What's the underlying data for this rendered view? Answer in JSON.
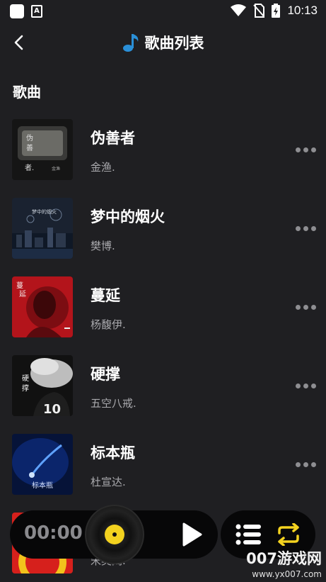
{
  "status_bar": {
    "time": "10:13",
    "notif_letter": "A"
  },
  "header": {
    "title": "歌曲列表",
    "back_icon": "back-arrow-icon",
    "note_icon": "music-note-icon",
    "accent": "#2a8fd8"
  },
  "section": {
    "label": "歌曲"
  },
  "songs": [
    {
      "title": "伪善者",
      "artist": "金渔."
    },
    {
      "title": "梦中的烟火",
      "artist": "樊博."
    },
    {
      "title": "蔓延",
      "artist": "杨馥伊."
    },
    {
      "title": "硬撑",
      "artist": "五空八戒."
    },
    {
      "title": "标本瓶",
      "artist": "杜宣达."
    },
    {
      "title": "",
      "artist": "宋奕阔."
    }
  ],
  "player": {
    "time": "00:00",
    "disc_color": "#f3d21f"
  },
  "watermark": {
    "brand": "007游戏网",
    "url": "www.yx007.com"
  }
}
